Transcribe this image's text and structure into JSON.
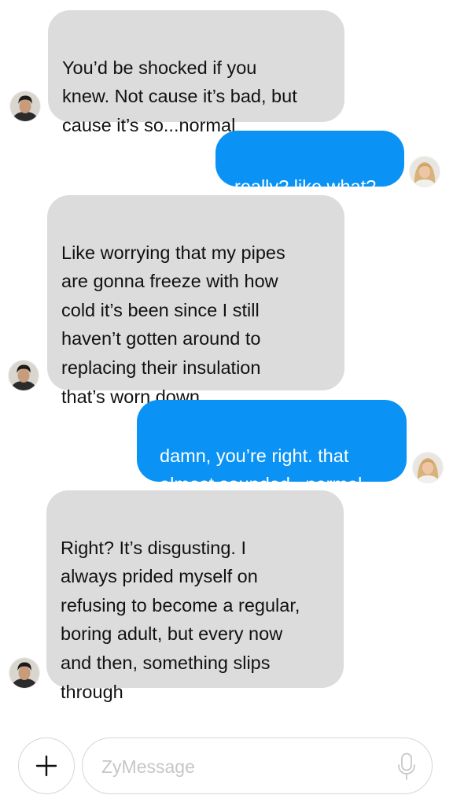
{
  "conversation": {
    "messages": [
      {
        "sender": "contact",
        "text": "You’d be shocked if you\nknew. Not cause it’s bad, but\ncause it’s so...normal"
      },
      {
        "sender": "me",
        "text": "really? like what?"
      },
      {
        "sender": "contact",
        "text": "Like worrying that my pipes\nare gonna freeze with how\ncold it’s been since I still\nhaven’t gotten around to\nreplacing their insulation\nthat’s worn down"
      },
      {
        "sender": "me",
        "text": "damn, you’re right. that\nalmost sounded...normal"
      },
      {
        "sender": "contact",
        "text": "Right? It’s disgusting. I\nalways prided myself on\nrefusing to become a regular,\nboring adult, but every now\nand then, something slips\nthrough"
      }
    ]
  },
  "composer": {
    "placeholder": "ZyMessage",
    "value": "",
    "add_icon": "plus-icon",
    "mic_icon": "microphone-icon"
  },
  "colors": {
    "incoming_bubble": "#dcdcdc",
    "outgoing_bubble": "#0a93f5",
    "incoming_text": "#111111",
    "outgoing_text": "#ffffff"
  }
}
